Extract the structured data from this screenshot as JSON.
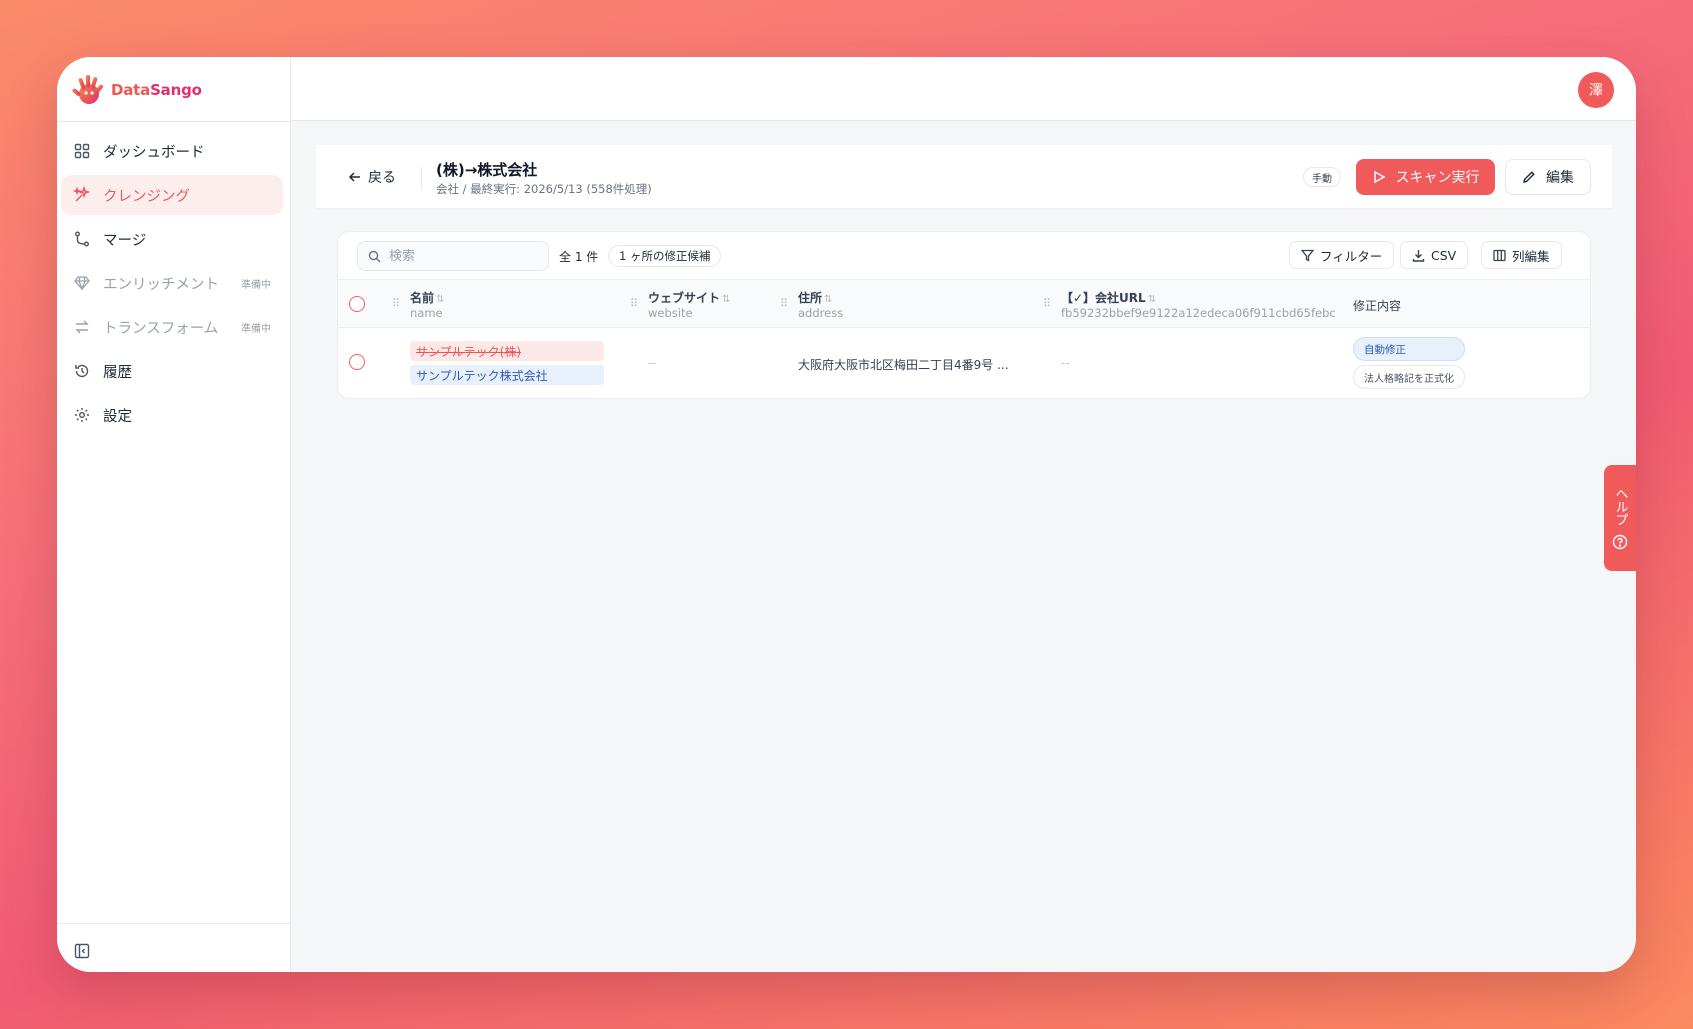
{
  "app": {
    "brand_a": "Data",
    "brand_b": "Sango",
    "user_initial": "澤",
    "accent": "#f05a5a"
  },
  "sidebar": {
    "items": [
      {
        "label": "ダッシュボード",
        "icon": "grid-icon"
      },
      {
        "label": "クレンジング",
        "icon": "sparkle-icon",
        "active": true
      },
      {
        "label": "マージ",
        "icon": "merge-icon"
      },
      {
        "label": "エンリッチメント",
        "icon": "diamond-icon",
        "badge": "準備中"
      },
      {
        "label": "トランスフォーム",
        "icon": "arrows-icon",
        "badge": "準備中"
      },
      {
        "label": "履歴",
        "icon": "history-icon"
      },
      {
        "label": "設定",
        "icon": "gear-icon"
      }
    ]
  },
  "header": {
    "back_label": "戻る",
    "title": "(株)→株式会社",
    "subtitle": "会社 / 最終実行: 2026/5/13 (558件処理)",
    "mode_badge": "手動",
    "scan_label": "スキャン実行",
    "edit_label": "編集"
  },
  "toolbar": {
    "search_placeholder": "検索",
    "count": "全 1 件",
    "candidates": "1 ヶ所の修正候補",
    "filter_label": "フィルター",
    "csv_label": "CSV",
    "columns_label": "列編集"
  },
  "table": {
    "columns": [
      {
        "label": "名前",
        "sub": "name"
      },
      {
        "label": "ウェブサイト",
        "sub": "website"
      },
      {
        "label": "住所",
        "sub": "address"
      },
      {
        "label": "【✓】会社URL",
        "sub": "fb59232bbef9e9122a12edeca06f911cbd65febc"
      },
      {
        "label": "修正内容",
        "sub": ""
      }
    ],
    "rows": [
      {
        "name_old": "サンプルテック(株)",
        "name_new": "サンプルテック株式会社",
        "website": "--",
        "address": "大阪府大阪市北区梅田二丁目4番9号 ...",
        "company_url": "--",
        "fix_tag": "自動修正",
        "fix_reason": "法人格略記を正式化"
      }
    ]
  },
  "help": {
    "label": "ヘルプ"
  }
}
